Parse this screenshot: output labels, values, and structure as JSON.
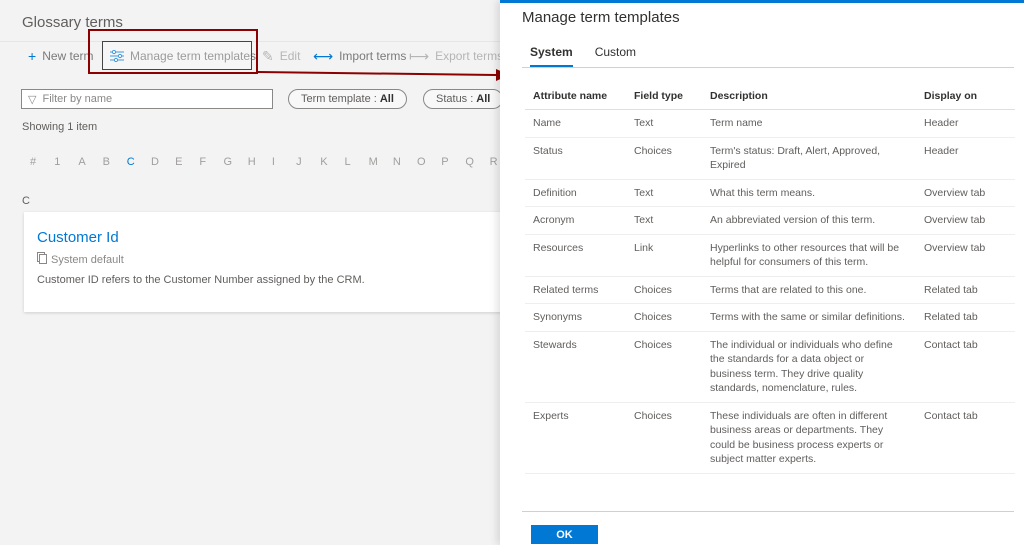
{
  "left": {
    "title": "Glossary terms",
    "toolbar": {
      "new_term": "New term",
      "manage_templates": "Manage term templates",
      "edit": "Edit",
      "import_terms": "Import terms",
      "export_terms": "Export terms"
    },
    "filter": {
      "placeholder": "Filter by name"
    },
    "pills": {
      "term_template_label": "Term template :",
      "term_template_value": "All",
      "status_label": "Status :",
      "status_value": "All"
    },
    "showing": "Showing 1 item",
    "alphabet": [
      "#",
      "1",
      "A",
      "B",
      "C",
      "D",
      "E",
      "F",
      "G",
      "H",
      "I",
      "J",
      "K",
      "L",
      "M",
      "N",
      "O",
      "P",
      "Q",
      "R"
    ],
    "active_letter": "C",
    "section_letter": "C",
    "card": {
      "title": "Customer Id",
      "template": "System default",
      "description": "Customer ID refers to the Customer Number assigned by the CRM."
    }
  },
  "panel": {
    "title": "Manage term templates",
    "tabs": [
      {
        "label": "System",
        "active": true
      },
      {
        "label": "Custom",
        "active": false
      }
    ],
    "columns": [
      "Attribute name",
      "Field type",
      "Description",
      "Display on"
    ],
    "rows": [
      [
        "Name",
        "Text",
        "Term name",
        "Header"
      ],
      [
        "Status",
        "Choices",
        "Term's status: Draft, Alert, Approved, Expired",
        "Header"
      ],
      [
        "Definition",
        "Text",
        "What this term means.",
        "Overview tab"
      ],
      [
        "Acronym",
        "Text",
        "An abbreviated version of this term.",
        "Overview tab"
      ],
      [
        "Resources",
        "Link",
        "Hyperlinks to other resources that will be helpful for consumers of this term.",
        "Overview tab"
      ],
      [
        "Related terms",
        "Choices",
        "Terms that are related to this one.",
        "Related tab"
      ],
      [
        "Synonyms",
        "Choices",
        "Terms with the same or similar definitions.",
        "Related tab"
      ],
      [
        "Stewards",
        "Choices",
        "The individual or individuals who define the standards for a data object or business term. They drive quality standards, nomenclature, rules.",
        "Contact tab"
      ],
      [
        "Experts",
        "Choices",
        "These individuals are often in different business areas or departments. They could be business process experts or subject matter experts.",
        "Contact tab"
      ]
    ],
    "ok_label": "OK"
  },
  "colors": {
    "accent": "#0078d4",
    "callout": "#8b0000"
  },
  "icons": {
    "new_term": "plus-icon",
    "manage_templates": "sliders-icon",
    "edit": "pencil-icon",
    "import": "import-arrow-icon",
    "export": "export-arrow-icon",
    "filter": "filter-icon",
    "template": "document-icon"
  }
}
